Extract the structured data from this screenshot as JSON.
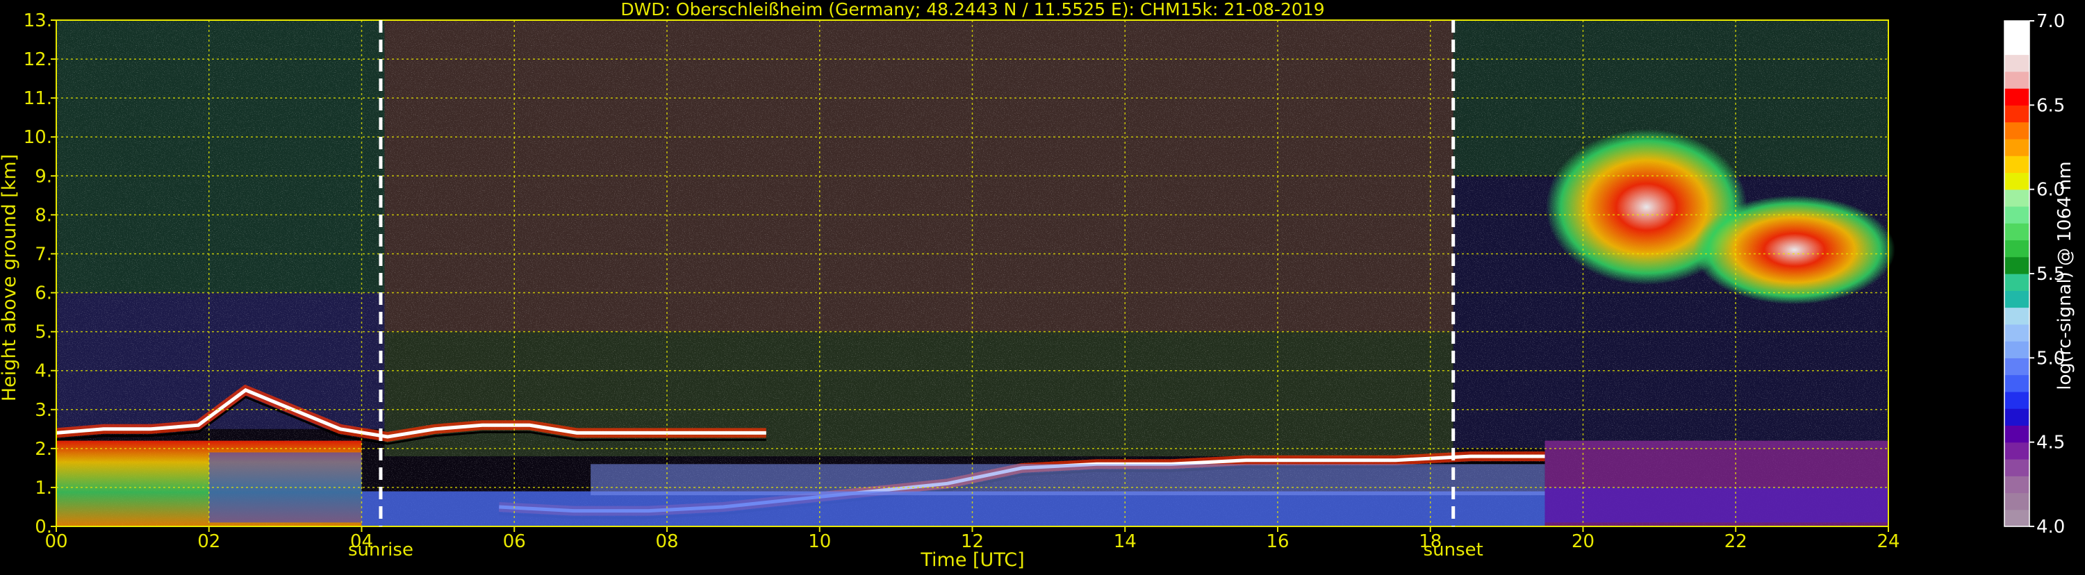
{
  "chart_data": {
    "type": "heatmap",
    "title": "DWD: Oberschleißheim (Germany; 48.2443 N / 11.5525 E):    CHM15k: 21-08-2019",
    "xlabel": "Time [UTC]",
    "ylabel": "Height above ground [km]",
    "xlim": [
      0,
      24
    ],
    "ylim": [
      0,
      13
    ],
    "x_ticks": [
      {
        "value": 0,
        "label": "00"
      },
      {
        "value": 2,
        "label": "02"
      },
      {
        "value": 4,
        "label": "04"
      },
      {
        "value": 6,
        "label": "06"
      },
      {
        "value": 8,
        "label": "08"
      },
      {
        "value": 10,
        "label": "10"
      },
      {
        "value": 12,
        "label": "12"
      },
      {
        "value": 14,
        "label": "14"
      },
      {
        "value": 16,
        "label": "16"
      },
      {
        "value": 18,
        "label": "18"
      },
      {
        "value": 20,
        "label": "20"
      },
      {
        "value": 22,
        "label": "22"
      },
      {
        "value": 24,
        "label": "24"
      }
    ],
    "y_ticks": [
      {
        "value": 0,
        "label": "0."
      },
      {
        "value": 1,
        "label": "1."
      },
      {
        "value": 2,
        "label": "2."
      },
      {
        "value": 3,
        "label": "3."
      },
      {
        "value": 4,
        "label": "4."
      },
      {
        "value": 5,
        "label": "5."
      },
      {
        "value": 6,
        "label": "6."
      },
      {
        "value": 7,
        "label": "7."
      },
      {
        "value": 8,
        "label": "8."
      },
      {
        "value": 9,
        "label": "9."
      },
      {
        "value": 10,
        "label": "10."
      },
      {
        "value": 11,
        "label": "11."
      },
      {
        "value": 12,
        "label": "12."
      },
      {
        "value": 13,
        "label": "13."
      }
    ],
    "grid": true,
    "annotations": [
      {
        "name": "sunrise",
        "label": "sunrise",
        "x": 4.25
      },
      {
        "name": "sunset",
        "label": "sunset",
        "x": 18.3
      }
    ],
    "colorbar": {
      "label": "log(rc-signal) @ 1064 nm",
      "range": [
        4.0,
        7.0
      ],
      "ticks": [
        {
          "value": 4.0,
          "label": "4.0"
        },
        {
          "value": 4.5,
          "label": "4.5"
        },
        {
          "value": 5.0,
          "label": "5.0"
        },
        {
          "value": 5.5,
          "label": "5.5"
        },
        {
          "value": 6.0,
          "label": "6.0"
        },
        {
          "value": 6.5,
          "label": "6.5"
        },
        {
          "value": 7.0,
          "label": "7.0"
        }
      ],
      "colors": [
        "#a890a8",
        "#a07ea0",
        "#9c6ca0",
        "#8e4aa0",
        "#7a22a0",
        "#5a00a8",
        "#1c10d0",
        "#2030f0",
        "#4060f8",
        "#6080f8",
        "#80a8f8",
        "#98c0f8",
        "#a8d8f0",
        "#20b8a8",
        "#30c890",
        "#109020",
        "#30c040",
        "#50d860",
        "#70e890",
        "#a0f0a0",
        "#e8f000",
        "#ffd000",
        "#ffa000",
        "#ff7800",
        "#ff3000",
        "#ff0000",
        "#f0b0b0",
        "#f0d8d8",
        "#ffffff",
        "#ffffff"
      ]
    },
    "features": [
      {
        "kind": "cloud",
        "x_start": 19.6,
        "x_end": 24.0,
        "y_bottom": 5.8,
        "y_top": 11.2,
        "peak_value": 6.8
      },
      {
        "kind": "layer-top",
        "x_start": 0.0,
        "x_end": 9.3,
        "height_km": [
          2.4,
          2.5,
          2.5,
          2.6,
          3.5,
          3.0,
          2.5,
          2.3,
          2.5,
          2.6,
          2.6,
          2.4,
          2.4,
          2.4,
          2.4,
          2.4
        ],
        "peak_value": 6.4
      },
      {
        "kind": "mixing-layer-top",
        "x_start": 5.8,
        "x_end": 19.5,
        "height_km": [
          0.5,
          0.4,
          0.4,
          0.5,
          0.7,
          0.9,
          1.1,
          1.5,
          1.6,
          1.6,
          1.7,
          1.7,
          1.7,
          1.8,
          1.8
        ],
        "peak_value": 6.5
      },
      {
        "kind": "boundary-layer",
        "x_start": 0.0,
        "x_end": 24.0,
        "y_bottom": 0.0,
        "y_top": 1.8,
        "peak_value": 6.2
      },
      {
        "kind": "residual-layer",
        "x_start": 19.5,
        "x_end": 24.0,
        "y_bottom": 0.0,
        "y_top": 2.2,
        "peak_value": 5.0
      }
    ]
  }
}
